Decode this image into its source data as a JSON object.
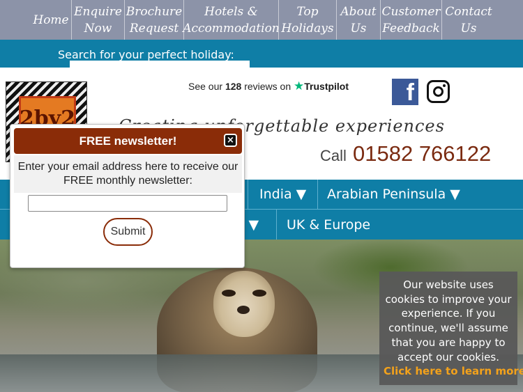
{
  "topnav": {
    "items": [
      {
        "label": "Home"
      },
      {
        "label": "Enquire\nNow"
      },
      {
        "label": "Brochure\nRequest"
      },
      {
        "label": "Hotels &\nAccommodation"
      },
      {
        "label": "Top\nHolidays"
      },
      {
        "label": "About\nUs"
      },
      {
        "label": "Customer\nFeedback"
      },
      {
        "label": "Contact\nUs"
      }
    ]
  },
  "search": {
    "label": "Search for your perfect holiday:"
  },
  "logo": {
    "text": "2by2"
  },
  "trustpilot": {
    "prefix": "See our",
    "count": "128",
    "suffix": "reviews on",
    "brand": "Trustpilot",
    "star": "★"
  },
  "social": {
    "facebook_glyph": "f",
    "icons": [
      "facebook-icon",
      "instagram-icon"
    ]
  },
  "header": {
    "tagline": "Creating unforgettable experiences",
    "call_label": "Call",
    "phone": "01582 766122"
  },
  "regions": {
    "row1": [
      {
        "label": "India ▼"
      },
      {
        "label": "Arabian Peninsula ▼"
      }
    ],
    "row2": [
      {
        "label": "t ▼"
      },
      {
        "label": "UK & Europe"
      }
    ]
  },
  "newsletter": {
    "title": "FREE newsletter!",
    "close_glyph": "×",
    "message": "Enter your email address here to receive our FREE monthly newsletter:",
    "email_value": "",
    "submit_label": "Submit"
  },
  "cookie": {
    "message": "Our website uses cookies to improve your experience. If you continue, we'll assume that you are happy to accept our cookies.",
    "link": "Click here to learn more"
  },
  "colors": {
    "nav_grey": "#8c93a8",
    "brand_teal": "#0f7ea6",
    "brand_brown": "#8a2c08",
    "cookie_link": "#f3a21b"
  }
}
